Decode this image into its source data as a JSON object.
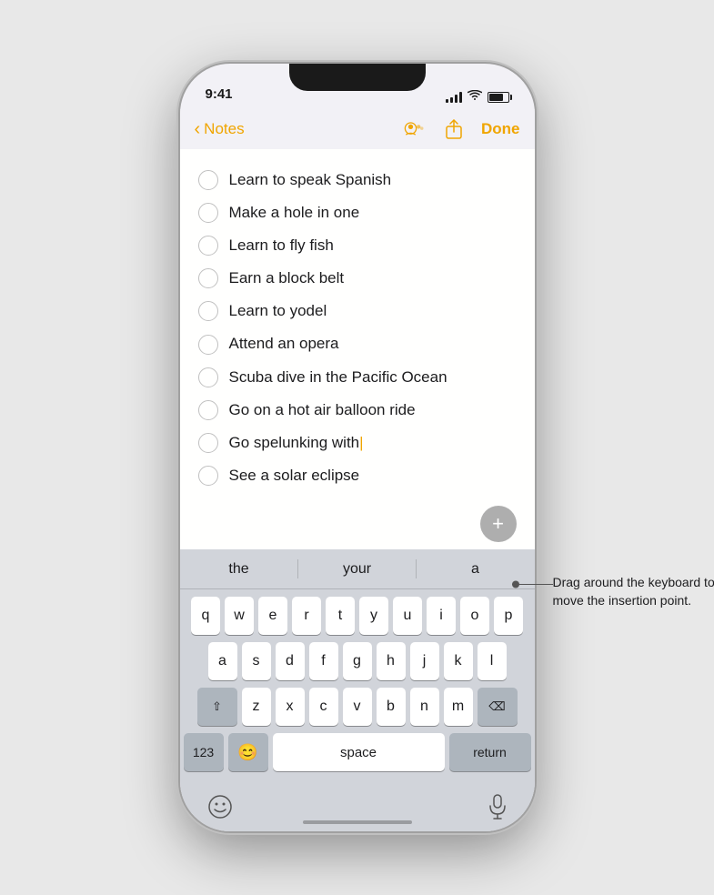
{
  "status": {
    "time": "9:41",
    "battery": 75
  },
  "nav": {
    "back_label": "Notes",
    "done_label": "Done"
  },
  "checklist": {
    "items": [
      {
        "id": 1,
        "text": "Learn to speak Spanish",
        "checked": false
      },
      {
        "id": 2,
        "text": "Make a hole in one",
        "checked": false
      },
      {
        "id": 3,
        "text": "Learn to fly fish",
        "checked": false
      },
      {
        "id": 4,
        "text": "Earn a block belt",
        "checked": false
      },
      {
        "id": 5,
        "text": "Learn to yodel",
        "checked": false
      },
      {
        "id": 6,
        "text": "Attend an opera",
        "checked": false
      },
      {
        "id": 7,
        "text": "Scuba dive in the Pacific Ocean",
        "checked": false
      },
      {
        "id": 8,
        "text": "Go on a hot air balloon ride",
        "checked": false
      },
      {
        "id": 9,
        "text": "Go spelunking with",
        "checked": false,
        "cursor": true
      },
      {
        "id": 10,
        "text": "See a solar eclipse",
        "checked": false
      }
    ]
  },
  "autocomplete": {
    "words": [
      "the",
      "your",
      "a"
    ]
  },
  "keyboard": {
    "row1": [
      "q",
      "w",
      "e",
      "r",
      "t",
      "y",
      "u",
      "i",
      "o",
      "p"
    ],
    "row2": [
      "a",
      "s",
      "d",
      "f",
      "g",
      "h",
      "j",
      "k",
      "l"
    ],
    "row3": [
      "z",
      "x",
      "c",
      "v",
      "b",
      "n",
      "m"
    ],
    "space_label": "space",
    "return_label": "return"
  },
  "annotation": {
    "text": "Drag around the keyboard to move the insertion point."
  },
  "add_button": "+"
}
